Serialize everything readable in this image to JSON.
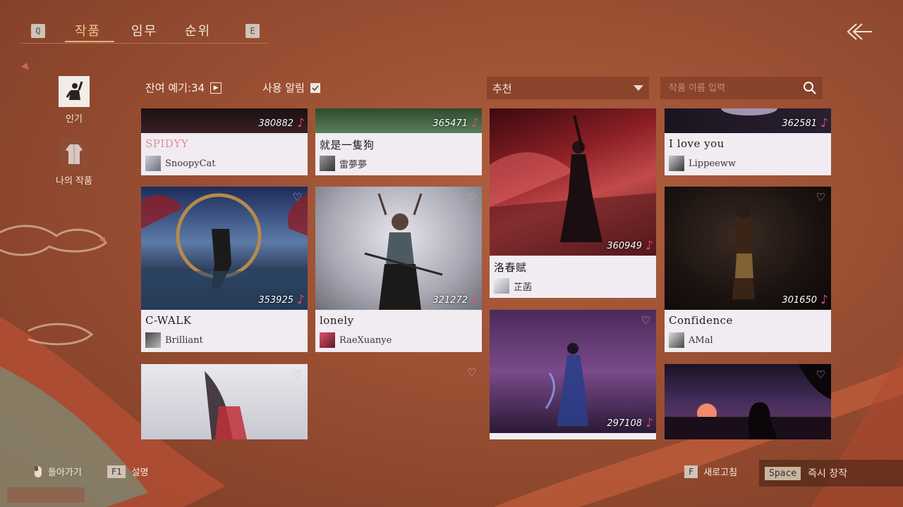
{
  "tabs": {
    "key_left": "Q",
    "key_right": "E",
    "items": [
      {
        "label": "작품",
        "active": true
      },
      {
        "label": "임무",
        "active": false
      },
      {
        "label": "순위",
        "active": false
      }
    ]
  },
  "sidenav": {
    "popular_label": "인기",
    "my_works_label": "나의 작품"
  },
  "filters": {
    "remaining_label": "잔여 예기:34",
    "notify_label": "사용 알림",
    "sort_value": "추천",
    "search_placeholder": "작품 이름 입력"
  },
  "cards": [
    {
      "title": "SPIDYY",
      "author": "SnoopyCat",
      "count": "380882"
    },
    {
      "title": "就是一隻狗",
      "author": "雷夢夢",
      "count": "365471"
    },
    {
      "title": "洛春赋",
      "author": "芷菡",
      "count": "360949"
    },
    {
      "title": "I love you",
      "author": "Lippeeww",
      "count": "362581"
    },
    {
      "title": "C-WALK",
      "author": "Brilliant",
      "count": "353925"
    },
    {
      "title": "lonely",
      "author": "RaeXuanye",
      "count": "321272"
    },
    {
      "title": "Confidence",
      "author": "AMal",
      "count": "301650"
    },
    {
      "title": "",
      "author": "",
      "count": "297108"
    }
  ],
  "bottom": {
    "back_label": "돌아가기",
    "help_key": "F1",
    "help_label": "설명",
    "refresh_key": "F",
    "refresh_label": "새로고침",
    "create_key": "Space",
    "create_label": "즉시 창작"
  },
  "colors": {
    "background": "#9a4f33",
    "accent": "#f0c58a",
    "note": "#e2496b",
    "card": "#f1ecf1"
  }
}
